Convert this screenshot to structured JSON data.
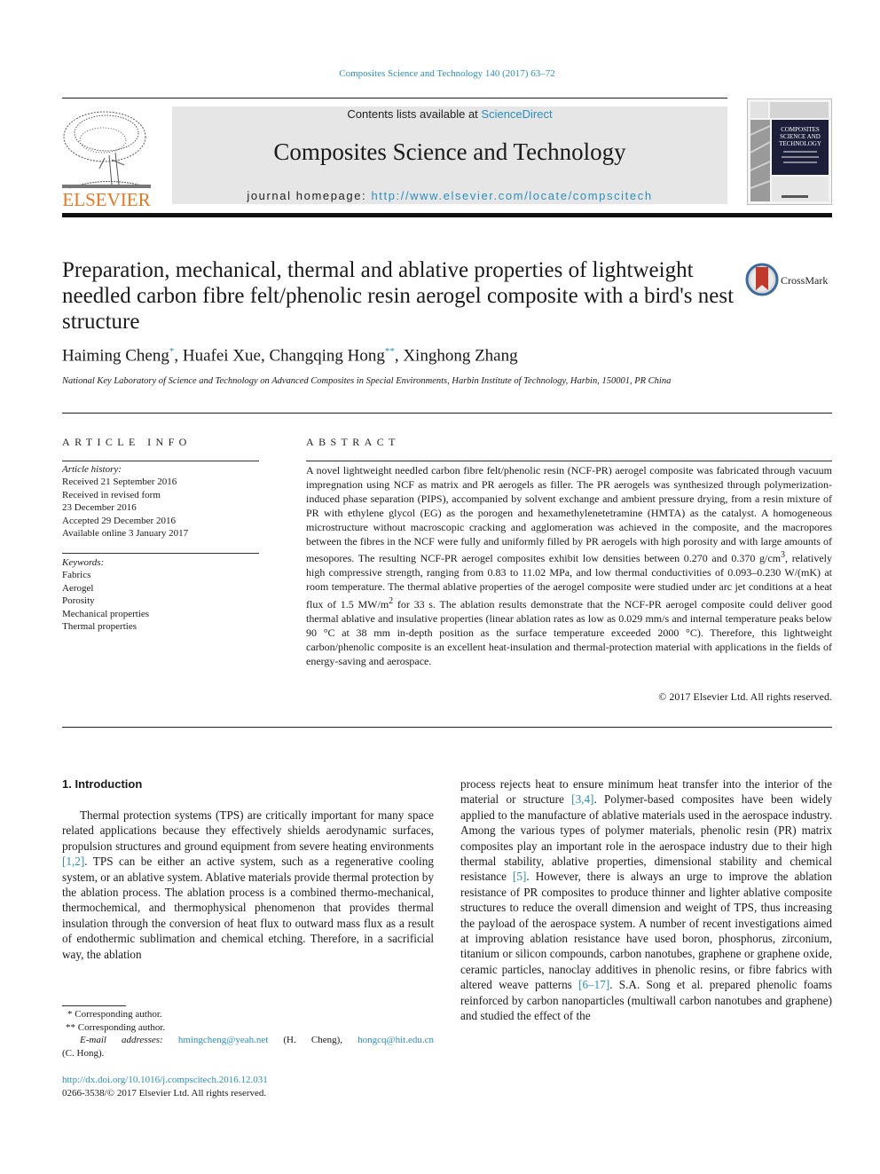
{
  "running_head": "Composites Science and Technology 140 (2017) 63–72",
  "masthead": {
    "publisher": "ELSEVIER",
    "contents_prefix": "Contents lists available at ",
    "contents_link": "ScienceDirect",
    "journal_name": "Composites Science and Technology",
    "homepage_prefix": "journal homepage: ",
    "homepage_url": "http://www.elsevier.com/locate/compscitech",
    "cover_title_lines": [
      "COMPOSITES",
      "SCIENCE AND",
      "TECHNOLOGY"
    ]
  },
  "article": {
    "title": "Preparation, mechanical, thermal and ablative properties of lightweight needled carbon fibre felt/phenolic resin aerogel composite with a bird's nest structure",
    "crossmark_label": "CrossMark",
    "authors": [
      {
        "name": "Haiming Cheng",
        "mark": "*",
        "sep": ", "
      },
      {
        "name": "Huafei Xue",
        "mark": "",
        "sep": ", "
      },
      {
        "name": "Changqing Hong",
        "mark": "**",
        "sep": ", "
      },
      {
        "name": "Xinghong Zhang",
        "mark": "",
        "sep": ""
      }
    ],
    "affiliation": "National Key Laboratory of Science and Technology on Advanced Composites in Special Environments, Harbin Institute of Technology, Harbin, 150001, PR China"
  },
  "article_info": {
    "heading": "ARTICLE INFO",
    "history_label": "Article history:",
    "history": [
      "Received 21 September 2016",
      "Received in revised form",
      "23 December 2016",
      "Accepted 29 December 2016",
      "Available online 3 January 2017"
    ],
    "keywords_label": "Keywords:",
    "keywords": [
      "Fabrics",
      "Aerogel",
      "Porosity",
      "Mechanical properties",
      "Thermal properties"
    ]
  },
  "abstract": {
    "heading": "ABSTRACT",
    "part1": "A novel lightweight needled carbon fibre felt/phenolic resin (NCF-PR) aerogel composite was fabricated through vacuum impregnation using NCF as matrix and PR aerogels as filler. The PR aerogels was synthesized through polymerization-induced phase separation (PIPS), accompanied by solvent exchange and ambient pressure drying, from a resin mixture of PR with ethylene glycol (EG) as the porogen and hexamethylenetetramine (HMTA) as the catalyst. A homogeneous microstructure without macroscopic cracking and agglomeration was achieved in the composite, and the macropores between the fibres in the NCF were fully and uniformly filled by PR aerogels with high porosity and with large amounts of mesopores. The resulting NCF-PR aerogel composites exhibit low densities between 0.270 and 0.370 g/cm",
    "sup1": "3",
    "part2": ", relatively high compressive strength, ranging from 0.83 to 11.02 MPa, and low thermal conductivities of 0.093–0.230 W/(mK) at room temperature. The thermal ablative properties of the aerogel composite were studied under arc jet conditions at a heat flux of 1.5 MW/m",
    "sup2": "2",
    "part3": " for 33 s. The ablation results demonstrate that the NCF-PR aerogel composite could deliver good thermal ablative and insulative properties (linear ablation rates as low as 0.029 mm/s and internal temperature peaks below 90 °C at 38 mm in-depth position as the surface temperature exceeded 2000 °C). Therefore, this lightweight carbon/phenolic composite is an excellent heat-insulation and thermal-protection material with applications in the fields of energy-saving and aerospace.",
    "copyright": "© 2017 Elsevier Ltd. All rights reserved."
  },
  "introduction": {
    "heading": "1.  Introduction",
    "left": {
      "t1": "Thermal protection systems (TPS) are critically important for many space related applications because they effectively shields aerodynamic surfaces, propulsion structures and ground equipment from severe heating environments ",
      "ref1": "[1,2]",
      "t2": ". TPS can be either an active system, such as a regenerative cooling system, or an ablative system. Ablative materials provide thermal protection by the ablation process. The ablation process is a combined thermo-mechanical, thermochemical, and thermophysical phenomenon that provides thermal insulation through the conversion of heat flux to outward mass flux as a result of endothermic sublimation and chemical etching. Therefore, in a sacrificial way, the ablation"
    },
    "right": {
      "t1": "process rejects heat to ensure minimum heat transfer into the interior of the material or structure ",
      "ref1": "[3,4]",
      "t2": ". Polymer-based composites have been widely applied to the manufacture of ablative materials used in the aerospace industry. Among the various types of polymer materials, phenolic resin (PR) matrix composites play an important role in the aerospace industry due to their high thermal stability, ablative properties, dimensional stability and chemical resistance ",
      "ref2": "[5]",
      "t3": ". However, there is always an urge to improve the ablation resistance of PR composites to produce thinner and lighter ablative composite structures to reduce the overall dimension and weight of TPS, thus increasing the payload of the aerospace system. A number of recent investigations aimed at improving ablation resistance have used boron, phosphorus, zirconium, titanium or silicon compounds, carbon nanotubes, graphene or graphene oxide, ceramic particles, nanoclay additives in phenolic resins, or fibre fabrics with altered weave patterns ",
      "ref3": "[6–17]",
      "t4": ". S.A. Song et al. prepared phenolic foams reinforced by carbon nanoparticles (multiwall carbon nanotubes and graphene) and studied the effect of the"
    }
  },
  "footnotes": {
    "fn1": "  * Corresponding author.",
    "fn2": "** Corresponding author.",
    "email_label": "E-mail addresses: ",
    "email1": "hmingcheng@yeah.net",
    "email1_owner": " (H. Cheng), ",
    "email2": "hongcq@hit.edu.cn",
    "email2_owner": "(C. Hong).",
    "doi": "http://dx.doi.org/10.1016/j.compscitech.2016.12.031",
    "issn": "0266-3538/© 2017 Elsevier Ltd. All rights reserved."
  }
}
